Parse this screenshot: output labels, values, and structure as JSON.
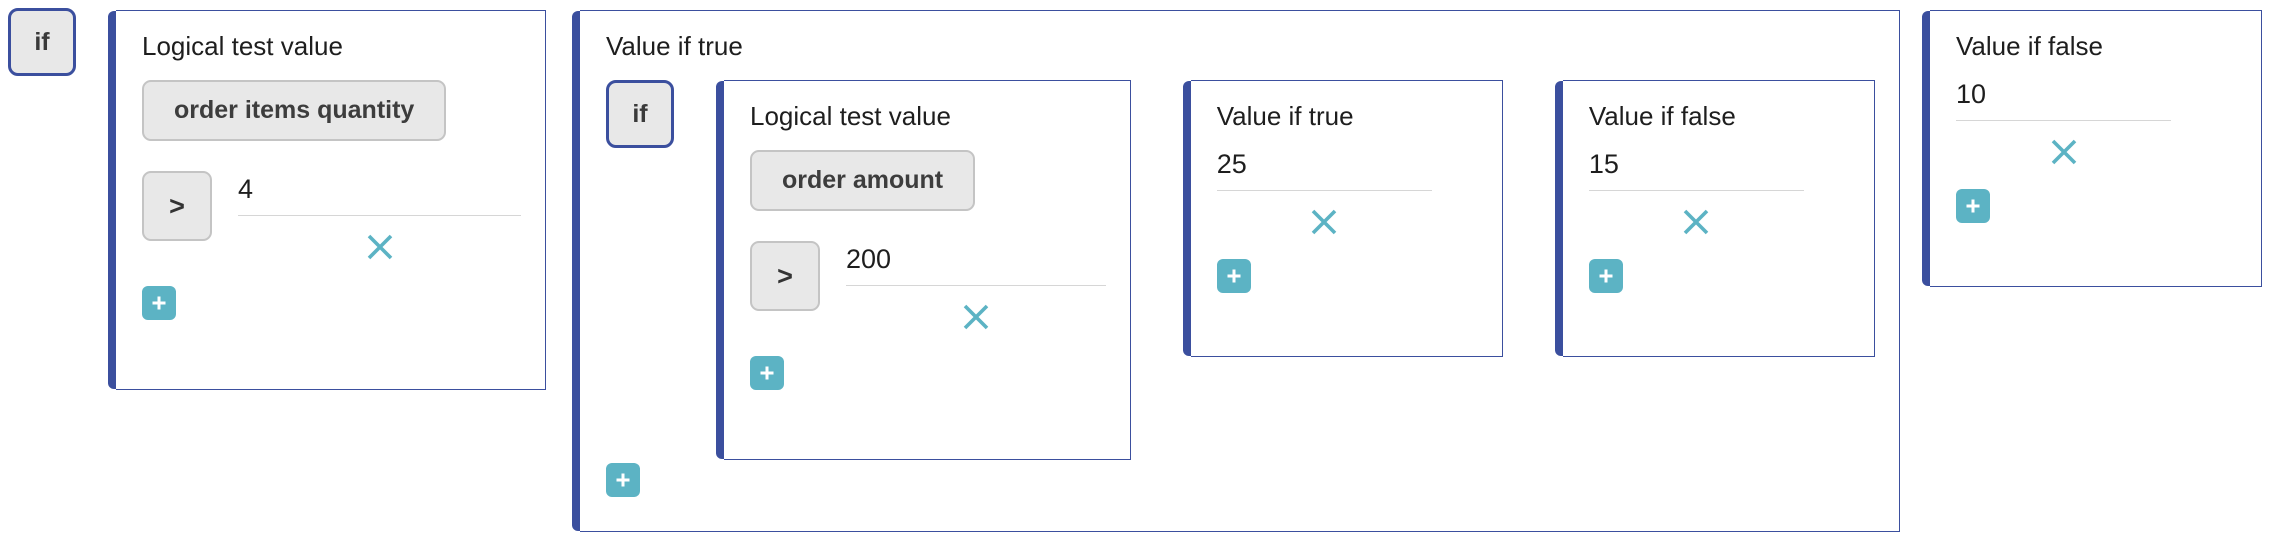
{
  "theme": {
    "accent_blue": "#3b4f9e",
    "teal": "#5cb3c4",
    "token_bg": "#e8e8e8",
    "token_border": "#c4c4c4",
    "rule": "#d6d6d6"
  },
  "root": {
    "if_label": "if",
    "logical_test": {
      "title": "Logical test value",
      "token": "order items quantity",
      "operator": ">",
      "value": "4",
      "remove_icon": "close-icon",
      "add_icon": "plus-icon"
    },
    "value_if_true": {
      "title": "Value if true",
      "if_label": "if",
      "add_icon": "plus-icon",
      "nested": {
        "logical_test": {
          "title": "Logical test value",
          "token": "order amount",
          "operator": ">",
          "value": "200",
          "remove_icon": "close-icon",
          "add_icon": "plus-icon"
        },
        "value_if_true": {
          "title": "Value if true",
          "value": "25",
          "remove_icon": "close-icon",
          "add_icon": "plus-icon"
        },
        "value_if_false": {
          "title": "Value if false",
          "value": "15",
          "remove_icon": "close-icon",
          "add_icon": "plus-icon"
        }
      }
    },
    "value_if_false": {
      "title": "Value if false",
      "value": "10",
      "remove_icon": "close-icon",
      "add_icon": "plus-icon"
    }
  }
}
